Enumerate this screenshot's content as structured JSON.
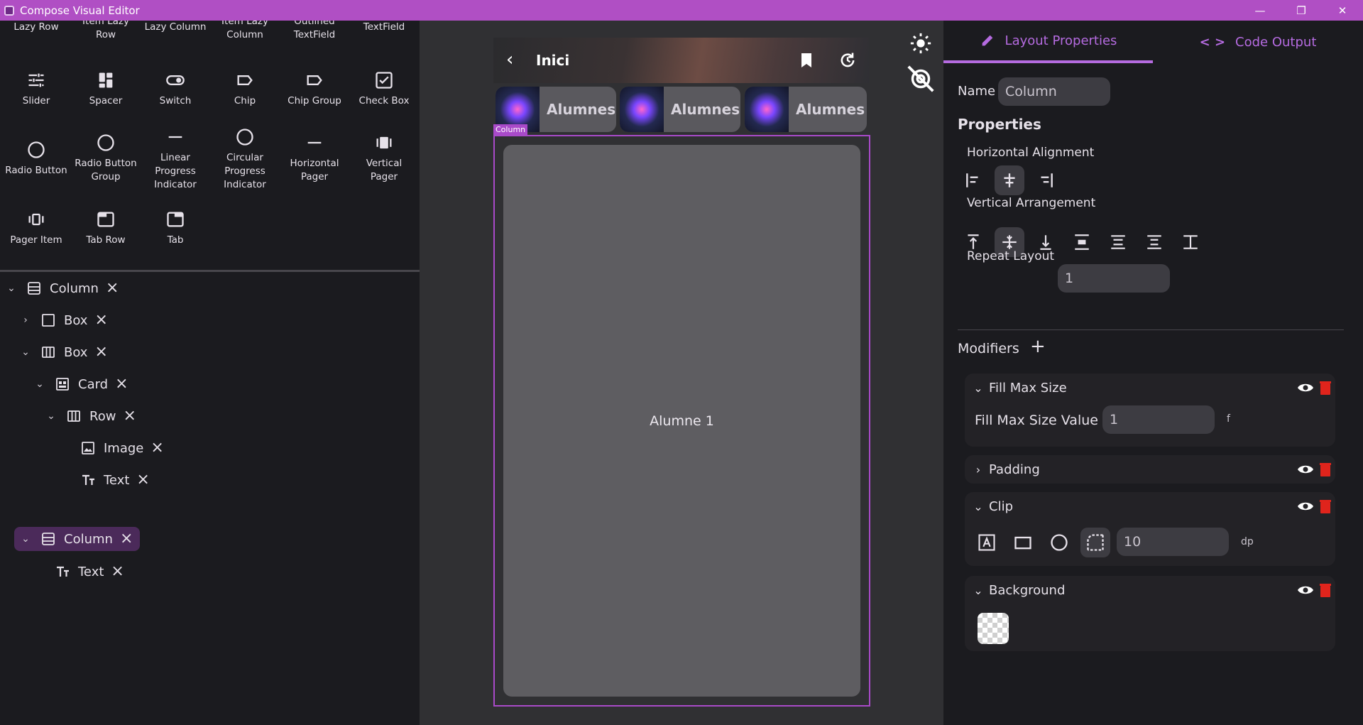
{
  "window": {
    "title": "Compose Visual Editor",
    "minimize": "—",
    "maximize": "❐",
    "close": "✕"
  },
  "palette": {
    "row1": [
      "Lazy Row",
      "Item Lazy\nRow",
      "Lazy Column",
      "Item Lazy\nColumn",
      "Outlined\nTextField",
      "TextField"
    ],
    "row2": [
      "Slider",
      "Spacer",
      "Switch",
      "Chip",
      "Chip Group",
      "Check Box"
    ],
    "row3": [
      "Radio Button",
      "Radio Button\nGroup",
      "Linear\nProgress\nIndicator",
      "Circular\nProgress\nIndicator",
      "Horizontal\nPager",
      "Vertical\nPager"
    ],
    "row4": [
      "Pager Item",
      "Tab Row",
      "Tab"
    ]
  },
  "tree": {
    "nodes": [
      {
        "label": "Column"
      },
      {
        "label": "Box"
      },
      {
        "label": "Box"
      },
      {
        "label": "Card"
      },
      {
        "label": "Row"
      },
      {
        "label": "Image"
      },
      {
        "label": "Text"
      },
      {
        "label": "Column"
      },
      {
        "label": "Text"
      }
    ]
  },
  "preview": {
    "topbar_title": "Inici",
    "chips": [
      "Alumnes",
      "Alumnes",
      "Alumnes"
    ],
    "selection_tag": "Column",
    "content_text": "Alumne 1"
  },
  "props": {
    "tab_layout": "Layout Properties",
    "tab_code": "Code Output",
    "name_label": "Name",
    "name_value": "Column",
    "properties_heading": "Properties",
    "h_align_label": "Horizontal Alignment",
    "v_arr_label": "Vertical Arrangement",
    "repeat_label": "Repeat Layout",
    "repeat_value": "1",
    "modifiers_heading": "Modifiers",
    "mod_fill": "Fill Max Size",
    "mod_fill_label": "Fill Max Size Value",
    "mod_fill_value": "1",
    "mod_fill_unit": "f",
    "mod_padding": "Padding",
    "mod_clip": "Clip",
    "mod_clip_value": "10",
    "mod_clip_unit": "dp",
    "mod_background": "Background"
  },
  "colors": {
    "accent": "#b56be0",
    "titlebar": "#b04fc4",
    "delete": "#e0241c"
  }
}
